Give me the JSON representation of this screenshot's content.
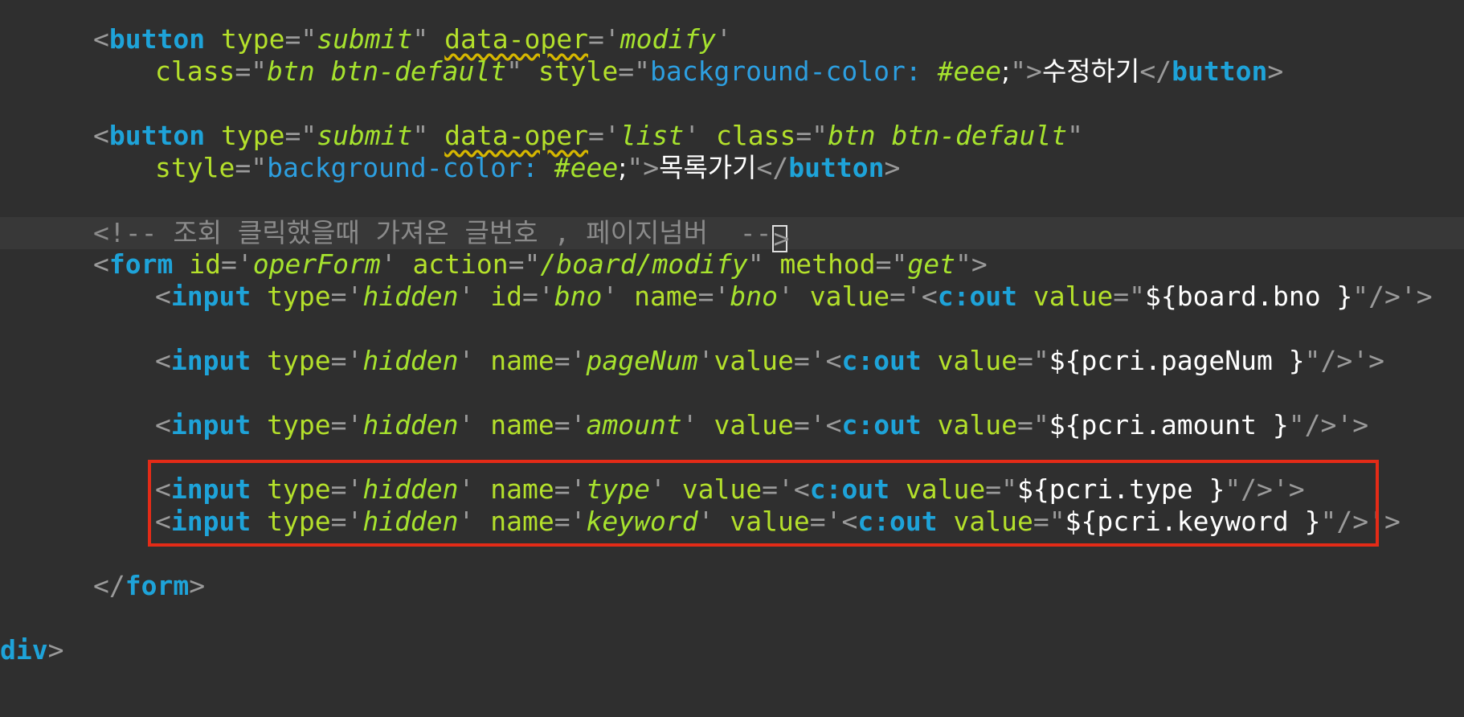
{
  "editor": {
    "modify_button": {
      "tag": "button",
      "attr_type": "type",
      "type_value": "submit",
      "attr_oper": "data-oper",
      "oper_value": "modify",
      "attr_class": "class",
      "class_value": "btn btn-default",
      "attr_style": "style",
      "style_prop": "background-color: ",
      "style_hex": "#eee",
      "style_semicolon": ";",
      "label": "수정하기"
    },
    "list_button": {
      "tag": "button",
      "attr_type": "type",
      "type_value": "submit",
      "attr_oper": "data-oper",
      "oper_value": "list",
      "attr_class": "class",
      "class_value": "btn btn-default",
      "attr_style": "style",
      "style_prop": "background-color: ",
      "style_hex": "#eee",
      "style_semicolon": ";",
      "label": "목록가기"
    },
    "comment": {
      "open": "<!-- ",
      "text": "조회 클릭했을때 가져온 글번호 , 페이지넘버  --",
      "cursor_char": ">"
    },
    "form": {
      "tag": "form",
      "attr_id": "id",
      "id_value": "operForm",
      "attr_action": "action",
      "action_value": "/board/modify",
      "attr_method": "method",
      "method_value": "get",
      "close_tag": "form"
    },
    "inputs": [
      {
        "tag": "input",
        "attr_type": "type",
        "type_value": "hidden",
        "attr_id": "id",
        "id_value": "bno",
        "attr_name": "name",
        "name_value": "bno",
        "attr_value": "value",
        "cout_tag": "c:out",
        "cout_attr": "value",
        "el": "${board.bno }"
      },
      {
        "tag": "input",
        "attr_type": "type",
        "type_value": "hidden",
        "attr_name": "name",
        "name_value": "pageNum",
        "attr_value": "value",
        "cout_tag": "c:out",
        "cout_attr": "value",
        "el": "${pcri.pageNum }"
      },
      {
        "tag": "input",
        "attr_type": "type",
        "type_value": "hidden",
        "attr_name": "name",
        "name_value": "amount",
        "attr_value": "value",
        "cout_tag": "c:out",
        "cout_attr": "value",
        "el": "${pcri.amount }"
      },
      {
        "tag": "input",
        "attr_type": "type",
        "type_value": "hidden",
        "attr_name": "name",
        "name_value": "type",
        "attr_value": "value",
        "cout_tag": "c:out",
        "cout_attr": "value",
        "el": "${pcri.type }"
      },
      {
        "tag": "input",
        "attr_type": "type",
        "type_value": "hidden",
        "attr_name": "name",
        "name_value": "keyword",
        "attr_value": "value",
        "cout_tag": "c:out",
        "cout_attr": "value",
        "el": "${pcri.keyword }"
      }
    ],
    "div_close": {
      "tag": "div"
    }
  },
  "colors": {
    "background": "#2f2f2f",
    "tag": "#1ea3d9",
    "attribute": "#b4e02b",
    "value": "#a6e22e",
    "comment": "#8a8a8a",
    "highlight_box": "#e42b17"
  }
}
